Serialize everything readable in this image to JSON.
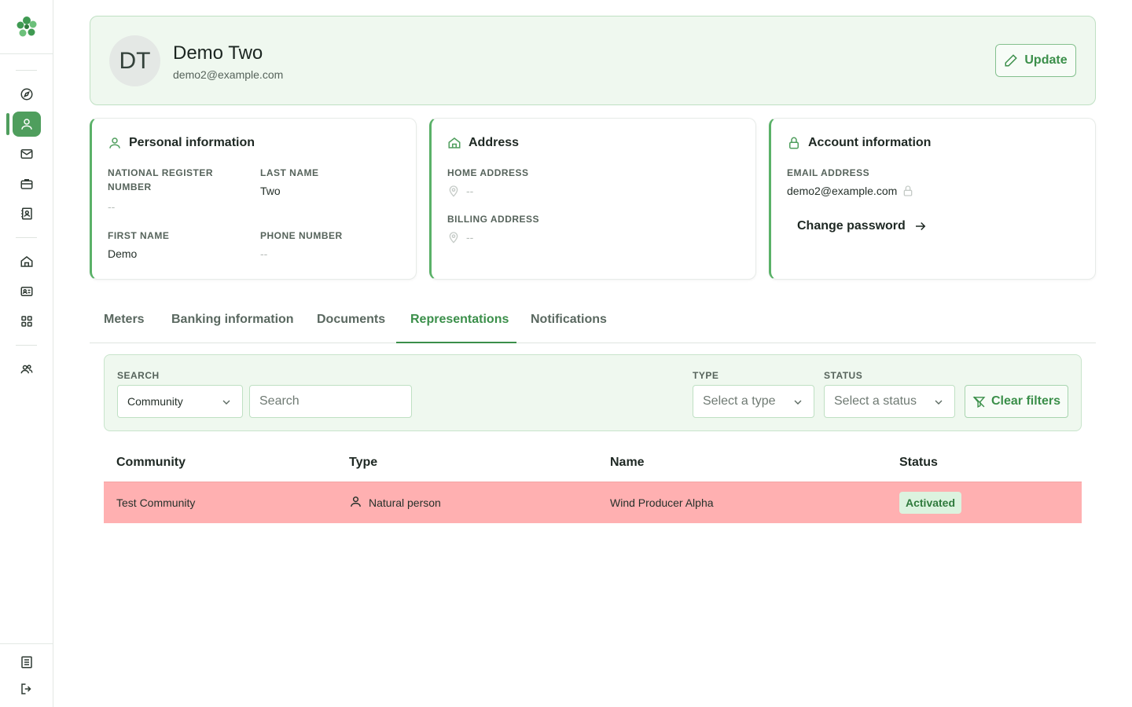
{
  "sidebar": {
    "items": [
      {
        "icon": "compass-icon"
      },
      {
        "icon": "user-icon",
        "active": true
      },
      {
        "icon": "mail-icon"
      },
      {
        "icon": "briefcase-icon"
      },
      {
        "icon": "contact-book-icon"
      },
      {
        "icon": "home-icon"
      },
      {
        "icon": "id-card-icon"
      },
      {
        "icon": "grid-icon"
      },
      {
        "icon": "users-icon"
      }
    ],
    "bottom": [
      {
        "icon": "document-icon"
      },
      {
        "icon": "logout-icon"
      }
    ]
  },
  "profile": {
    "initials": "DT",
    "name": "Demo Two",
    "email": "demo2@example.com",
    "update_label": "Update"
  },
  "personal": {
    "title": "Personal information",
    "national_register_label": "National register number",
    "national_register_value": "--",
    "last_name_label": "Last name",
    "last_name_value": "Two",
    "first_name_label": "First name",
    "first_name_value": "Demo",
    "phone_label": "Phone number",
    "phone_value": "--"
  },
  "address": {
    "title": "Address",
    "home_label": "Home address",
    "home_value": "--",
    "billing_label": "Billing address",
    "billing_value": "--"
  },
  "account": {
    "title": "Account information",
    "email_label": "Email address",
    "email_value": "demo2@example.com",
    "change_password_label": "Change password"
  },
  "tabs": [
    "Meters",
    "Banking information",
    "Documents",
    "Representations",
    "Notifications"
  ],
  "active_tab": "Representations",
  "filters": {
    "search_label": "SEARCH",
    "search_field_value": "Community",
    "search_placeholder": "Search",
    "type_label": "TYPE",
    "type_placeholder": "Select a type",
    "status_label": "STATUS",
    "status_placeholder": "Select a status",
    "clear_label": "Clear filters"
  },
  "table": {
    "headers": [
      "Community",
      "Type",
      "Name",
      "Status"
    ],
    "rows": [
      {
        "community": "Test Community",
        "type": "Natural person",
        "name": "Wind Producer Alpha",
        "status": "Activated"
      }
    ]
  },
  "colors": {
    "accent": "#4f9e5d",
    "accent_text": "#3b8f4a",
    "row_highlight": "#ffb0b1",
    "badge_bg": "#dcf3df"
  }
}
